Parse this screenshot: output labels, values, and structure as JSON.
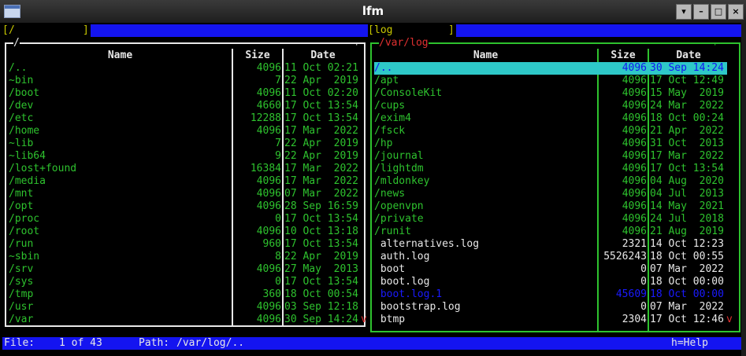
{
  "window": {
    "title": "lfm"
  },
  "left": {
    "path_input": "/",
    "title": "/",
    "headers": {
      "name": "Name",
      "size": "Size",
      "date": "Date"
    },
    "more_marker": "v",
    "rows": [
      {
        "n": "/..",
        "s": "4096",
        "d": "11 Oct 02:21"
      },
      {
        "n": "~bin",
        "s": "7",
        "d": "22 Apr  2019"
      },
      {
        "n": "/boot",
        "s": "4096",
        "d": "11 Oct 02:20"
      },
      {
        "n": "/dev",
        "s": "4660",
        "d": "17 Oct 13:54"
      },
      {
        "n": "/etc",
        "s": "12288",
        "d": "17 Oct 13:54"
      },
      {
        "n": "/home",
        "s": "4096",
        "d": "17 Mar  2022"
      },
      {
        "n": "~lib",
        "s": "7",
        "d": "22 Apr  2019"
      },
      {
        "n": "~lib64",
        "s": "9",
        "d": "22 Apr  2019"
      },
      {
        "n": "/lost+found",
        "s": "16384",
        "d": "17 Mar  2022"
      },
      {
        "n": "/media",
        "s": "4096",
        "d": "17 Mar  2022"
      },
      {
        "n": "/mnt",
        "s": "4096",
        "d": "07 Mar  2022"
      },
      {
        "n": "/opt",
        "s": "4096",
        "d": "28 Sep 16:59"
      },
      {
        "n": "/proc",
        "s": "0",
        "d": "17 Oct 13:54"
      },
      {
        "n": "/root",
        "s": "4096",
        "d": "10 Oct 13:18"
      },
      {
        "n": "/run",
        "s": "960",
        "d": "17 Oct 13:54"
      },
      {
        "n": "~sbin",
        "s": "8",
        "d": "22 Apr  2019"
      },
      {
        "n": "/srv",
        "s": "4096",
        "d": "27 May  2013"
      },
      {
        "n": "/sys",
        "s": "0",
        "d": "17 Oct 13:54"
      },
      {
        "n": "/tmp",
        "s": "360",
        "d": "18 Oct 00:54"
      },
      {
        "n": "/usr",
        "s": "4096",
        "d": "03 Sep 12:18"
      },
      {
        "n": "/var",
        "s": "4096",
        "d": "30 Sep 14:24"
      }
    ]
  },
  "right": {
    "path_input": "log",
    "title": "/var/log",
    "headers": {
      "name": "Name",
      "size": "Size",
      "date": "Date"
    },
    "more_marker": "v",
    "rows": [
      {
        "n": "/..",
        "s": "4096",
        "d": "30 Sep 14:24",
        "t": "sel"
      },
      {
        "n": "/apt",
        "s": "4096",
        "d": "17 Oct 12:49",
        "t": "dir"
      },
      {
        "n": "/ConsoleKit",
        "s": "4096",
        "d": "15 May  2019",
        "t": "dir"
      },
      {
        "n": "/cups",
        "s": "4096",
        "d": "24 Mar  2022",
        "t": "dir"
      },
      {
        "n": "/exim4",
        "s": "4096",
        "d": "18 Oct 00:24",
        "t": "dir"
      },
      {
        "n": "/fsck",
        "s": "4096",
        "d": "21 Apr  2022",
        "t": "dir"
      },
      {
        "n": "/hp",
        "s": "4096",
        "d": "31 Oct  2013",
        "t": "dir"
      },
      {
        "n": "/journal",
        "s": "4096",
        "d": "17 Mar  2022",
        "t": "dir"
      },
      {
        "n": "/lightdm",
        "s": "4096",
        "d": "17 Oct 13:54",
        "t": "dir"
      },
      {
        "n": "/mldonkey",
        "s": "4096",
        "d": "04 Aug  2020",
        "t": "dir"
      },
      {
        "n": "/news",
        "s": "4096",
        "d": "04 Jul  2013",
        "t": "dir"
      },
      {
        "n": "/openvpn",
        "s": "4096",
        "d": "14 May  2021",
        "t": "dir"
      },
      {
        "n": "/private",
        "s": "4096",
        "d": "24 Jul  2018",
        "t": "dir"
      },
      {
        "n": "/runit",
        "s": "4096",
        "d": "21 Aug  2019",
        "t": "dir"
      },
      {
        "n": " alternatives.log",
        "s": "2321",
        "d": "14 Oct 12:23",
        "t": "file"
      },
      {
        "n": " auth.log",
        "s": "5526243",
        "d": "18 Oct 00:55",
        "t": "file"
      },
      {
        "n": " boot",
        "s": "0",
        "d": "07 Mar  2022",
        "t": "file"
      },
      {
        "n": " boot.log",
        "s": "0",
        "d": "18 Oct 00:00",
        "t": "file"
      },
      {
        "n": " boot.log.1",
        "s": "45609",
        "d": "18 Oct 00:00",
        "t": "blue"
      },
      {
        "n": " bootstrap.log",
        "s": "0",
        "d": "07 Mar  2022",
        "t": "file"
      },
      {
        "n": " btmp",
        "s": "2304",
        "d": "17 Oct 12:46",
        "t": "file"
      }
    ]
  },
  "status": {
    "file_label": "File:",
    "file_pos": "1 of 43",
    "path_label": "Path:",
    "path_value": "/var/log/..",
    "help": "h=Help"
  },
  "colors": {
    "green": "#2ec22e",
    "yellow": "#c8c800",
    "blue": "#1414f0",
    "cyan": "#2ec8c8",
    "red": "#e03030"
  }
}
